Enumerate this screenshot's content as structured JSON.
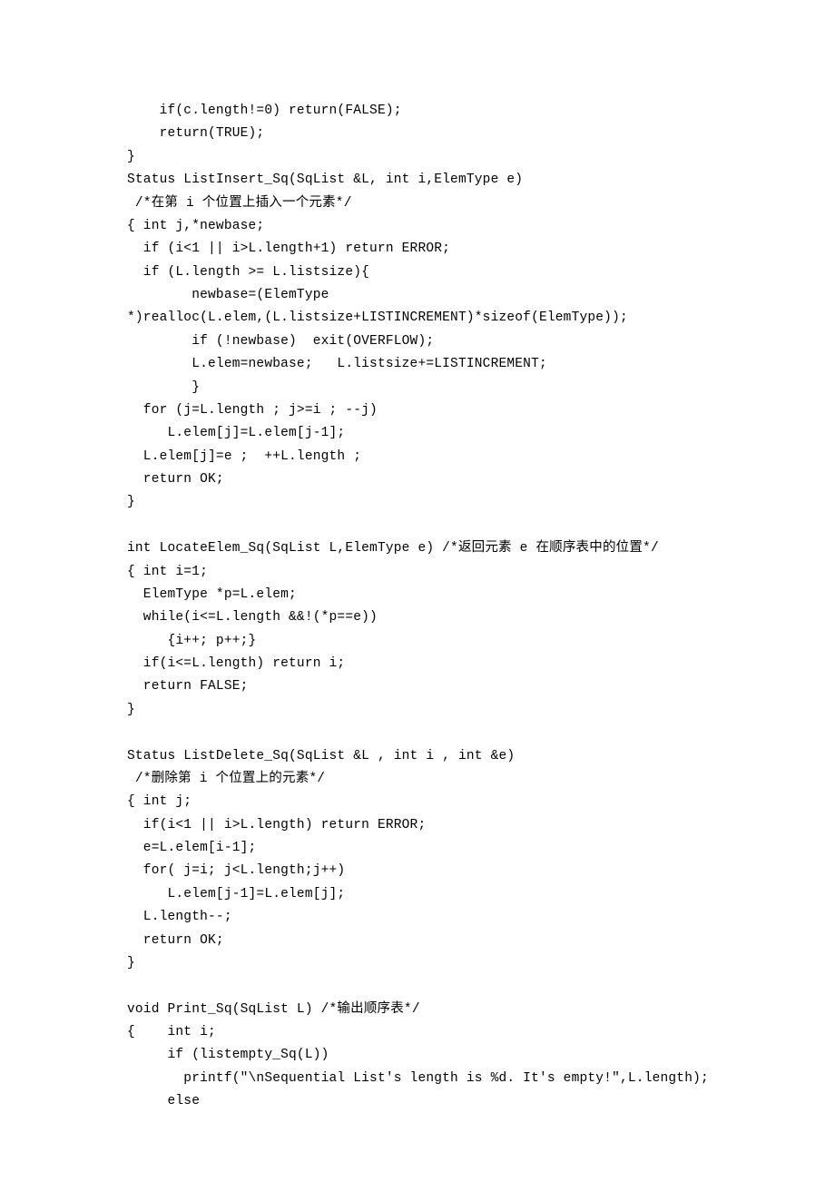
{
  "code_lines": [
    "    if(c.length!=0) return(FALSE);",
    "    return(TRUE);",
    "}",
    "Status ListInsert_Sq(SqList &L, int i,ElemType e)",
    " /*在第 i 个位置上插入一个元素*/",
    "{ int j,*newbase;",
    "  if (i<1 || i>L.length+1) return ERROR;",
    "  if (L.length >= L.listsize){",
    "        newbase=(ElemType",
    "*)realloc(L.elem,(L.listsize+LISTINCREMENT)*sizeof(ElemType));",
    "        if (!newbase)  exit(OVERFLOW);",
    "        L.elem=newbase;   L.listsize+=LISTINCREMENT;",
    "        }",
    "  for (j=L.length ; j>=i ; --j)",
    "     L.elem[j]=L.elem[j-1];",
    "  L.elem[j]=e ;  ++L.length ;",
    "  return OK;",
    "}",
    "",
    "int LocateElem_Sq(SqList L,ElemType e) /*返回元素 e 在顺序表中的位置*/",
    "{ int i=1;",
    "  ElemType *p=L.elem;",
    "  while(i<=L.length &&!(*p==e))",
    "     {i++; p++;}",
    "  if(i<=L.length) return i;",
    "  return FALSE;",
    "}",
    "",
    "Status ListDelete_Sq(SqList &L , int i , int &e)",
    " /*删除第 i 个位置上的元素*/",
    "{ int j;",
    "  if(i<1 || i>L.length) return ERROR;",
    "  e=L.elem[i-1];",
    "  for( j=i; j<L.length;j++)",
    "     L.elem[j-1]=L.elem[j];",
    "  L.length--;",
    "  return OK;",
    "}",
    "",
    "void Print_Sq(SqList L) /*输出顺序表*/",
    "{    int i;",
    "     if (listempty_Sq(L))",
    "       printf(\"\\nSequential List's length is %d. It's empty!\",L.length);",
    "     else"
  ]
}
